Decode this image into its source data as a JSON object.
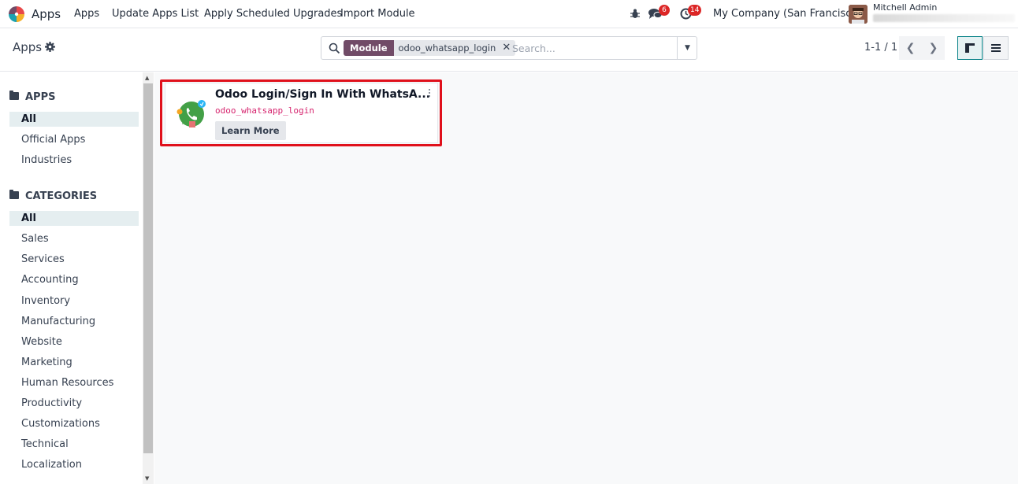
{
  "navbar": {
    "app_name": "Apps",
    "menus": [
      "Apps",
      "Update Apps List",
      "Apply Scheduled Upgrades",
      "Import Module"
    ],
    "messages_count": "6",
    "activities_count": "14",
    "company": "My Company (San Francisco)",
    "user_name": "Mitchell Admin"
  },
  "control": {
    "breadcrumb": "Apps",
    "facet_label": "Module",
    "facet_value": "odoo_whatsapp_login",
    "search_placeholder": "Search...",
    "pager": "1-1 / 1"
  },
  "sidebar": {
    "apps_title": "APPS",
    "apps_items": [
      "All",
      "Official Apps",
      "Industries"
    ],
    "categories_title": "CATEGORIES",
    "category_items": [
      "All",
      "Sales",
      "Services",
      "Accounting",
      "Inventory",
      "Manufacturing",
      "Website",
      "Marketing",
      "Human Resources",
      "Productivity",
      "Customizations",
      "Technical",
      "Localization"
    ]
  },
  "card": {
    "title": "Odoo Login/Sign In With WhatsA...",
    "technical_name": "odoo_whatsapp_login",
    "button_label": "Learn More"
  },
  "colors": {
    "brand": "#714b67",
    "accent": "#017e84",
    "highlight_border": "#e0101b",
    "badge": "#dc2626",
    "technical_name": "#d6246e"
  }
}
